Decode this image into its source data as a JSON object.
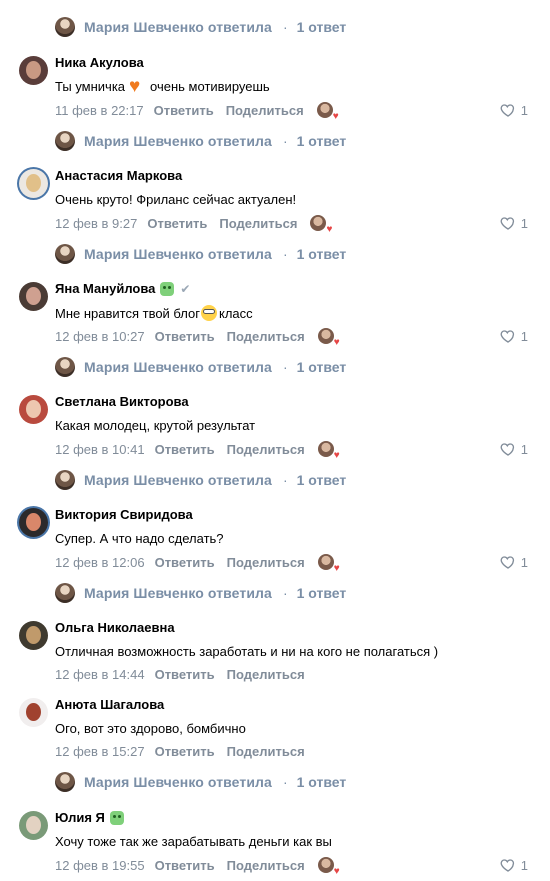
{
  "ui": {
    "like_count": "1",
    "reply_author": "Мария Шевченко ответила",
    "reply_count": "1 ответ",
    "reply_label": "Ответить",
    "share_label": "Поделиться",
    "dot": "·"
  },
  "comments": [
    {
      "author": "Ника Акулова",
      "text_before": "Ты умничка",
      "emoji": "orange-heart",
      "text_after": "очень мотивируешь",
      "date": "11 фев в 22:17",
      "has_like": true
    },
    {
      "author": "Анастасия Маркова",
      "text": "Очень круто! Фриланс сейчас актуален!",
      "date": "12 фев в 9:27",
      "has_like": true
    },
    {
      "author": "Яна Мануйлова",
      "text_before": "Мне нравится твой блог",
      "emoji": "grin-face",
      "text_after": "класс",
      "date": "12 фев в 10:27",
      "has_like": true
    },
    {
      "author": "Светлана Викторова",
      "text": "Какая молодец, крутой результат",
      "date": "12 фев в 10:41",
      "has_like": true
    },
    {
      "author": "Виктория Свиридова",
      "text": "Супер. А что надо сделать?",
      "date": "12 фев в 12:06",
      "has_like": true
    },
    {
      "author": "Ольга Николаевна",
      "text": "Отличная возможность заработать и ни на кого не полагаться )",
      "date": "12 фев в 14:44",
      "has_like": false
    },
    {
      "author": "Анюта Шагалова",
      "text": "Ого, вот это здорово, бомбично",
      "date": "12 фев в 15:27",
      "has_like": false
    },
    {
      "author": "Юлия Я",
      "text": "Хочу тоже так же зарабатывать деньги как вы",
      "date": "12 фев в 19:55",
      "has_like": true
    }
  ]
}
